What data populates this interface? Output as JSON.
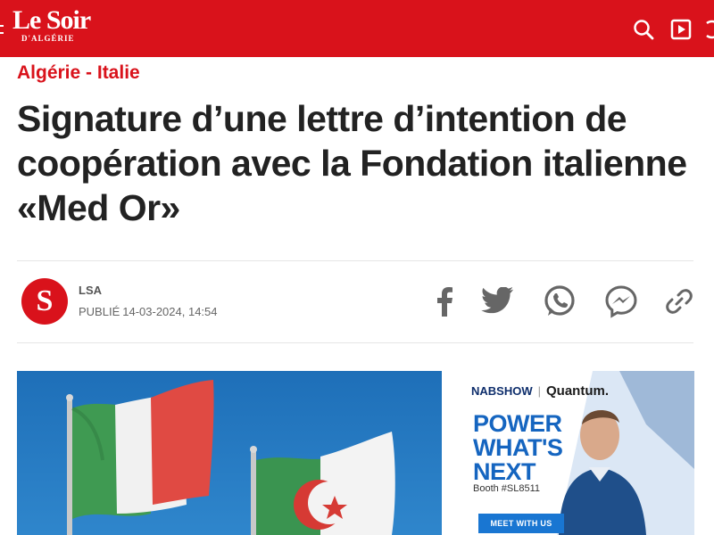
{
  "header": {
    "logo_main": "Le Soir",
    "logo_sub": "D'ALGÉRIE",
    "icons": [
      "menu-icon",
      "search-icon",
      "video-play-icon",
      "refresh-icon"
    ]
  },
  "article": {
    "category": "Algérie - Italie",
    "title": "Signature d’une lettre d’intention de coopération avec la Fondation italienne «Med Or»",
    "avatar_letter": "S",
    "author": "LSA",
    "published_label": "PUBLIÉ",
    "published_date": "14-03-2024, 14:54"
  },
  "share": {
    "icons": [
      "facebook-icon",
      "twitter-icon",
      "whatsapp-icon",
      "messenger-icon",
      "link-icon"
    ]
  },
  "ad": {
    "brand_a": "NABSHOW",
    "brand_b": "Quantum.",
    "headline_1": "POWER",
    "headline_2": "WHAT'S",
    "headline_3": "NEXT",
    "booth": "Booth #SL8511",
    "cta": "MEET WITH US"
  },
  "colors": {
    "brand_red": "#d9121b",
    "headline_text": "#222222",
    "ad_blue": "#1565c0",
    "share_icon_gray": "#666666"
  }
}
